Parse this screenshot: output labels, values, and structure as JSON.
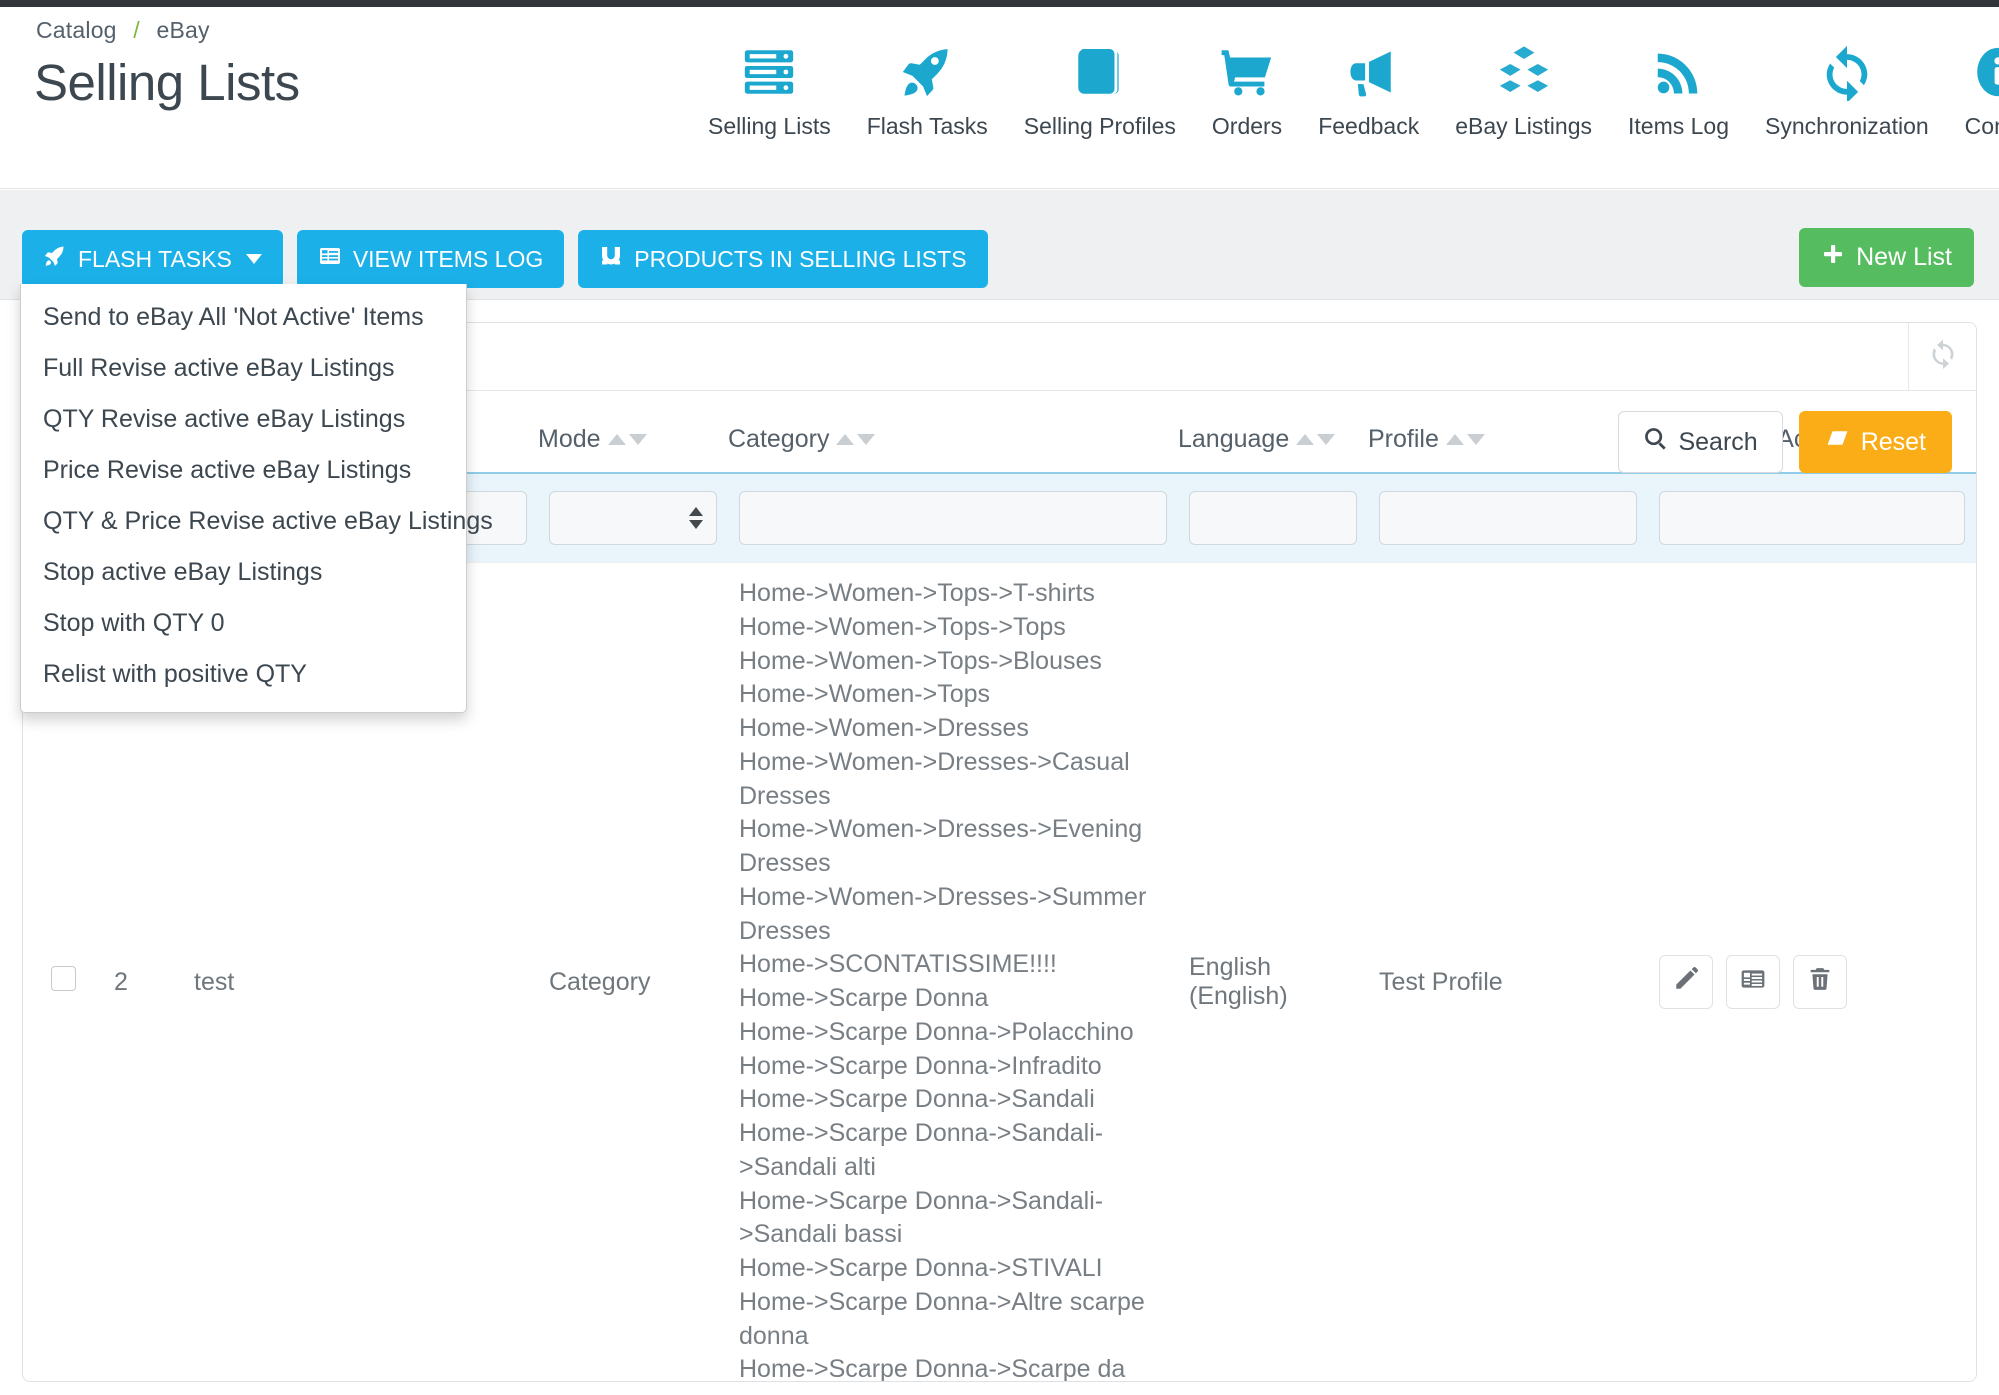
{
  "breadcrumb": {
    "root": "Catalog",
    "separator": "/",
    "current": "eBay"
  },
  "page_title": "Selling Lists",
  "colors": {
    "nav_icon": "#1ba7ce",
    "primary_button": "#1cb0e8",
    "new_button": "#55bd5f",
    "reset_button": "#fbad18",
    "filter_row_bg": "#e9f4fb",
    "breadcrumb_separator": "#7ab83e"
  },
  "nav": {
    "items": [
      {
        "label": "Selling Lists",
        "icon": "server-list-icon"
      },
      {
        "label": "Flash Tasks",
        "icon": "rocket-icon"
      },
      {
        "label": "Selling Profiles",
        "icon": "book-icon"
      },
      {
        "label": "Orders",
        "icon": "shopping-cart-icon"
      },
      {
        "label": "Feedback",
        "icon": "megaphone-icon"
      },
      {
        "label": "eBay Listings",
        "icon": "boxes-icon"
      },
      {
        "label": "Items Log",
        "icon": "rss-icon"
      },
      {
        "label": "Synchronization",
        "icon": "sync-icon"
      },
      {
        "label": "Config",
        "icon": "info-circle-icon"
      }
    ]
  },
  "toolbar": {
    "flash_tasks_label": "FLASH TASKS",
    "view_items_log_label": "VIEW ITEMS LOG",
    "products_in_selling_lists_label": "PRODUCTS IN SELLING LISTS",
    "new_list_label": "New List"
  },
  "flash_tasks_menu": {
    "open": true,
    "items": [
      "Send to eBay All 'Not Active' Items",
      "Full Revise active eBay Listings",
      "QTY Revise active eBay Listings",
      "Price Revise active eBay Listings",
      "QTY & Price Revise active eBay Listings",
      "Stop active eBay Listings",
      "Stop with QTY 0",
      "Relist with positive QTY"
    ]
  },
  "panel": {
    "search_label": "Search",
    "reset_label": "Reset",
    "refresh_icon": "refresh-icon"
  },
  "table": {
    "columns": [
      {
        "key": "select",
        "label": "",
        "sortable": false
      },
      {
        "key": "id",
        "label": "",
        "sortable": false
      },
      {
        "key": "name",
        "label": "",
        "sortable": false
      },
      {
        "key": "mode",
        "label": "Mode",
        "sortable": true
      },
      {
        "key": "category",
        "label": "Category",
        "sortable": true
      },
      {
        "key": "language",
        "label": "Language",
        "sortable": true
      },
      {
        "key": "profile",
        "label": "Profile",
        "sortable": true
      },
      {
        "key": "action",
        "label": "Action",
        "sortable": false
      }
    ],
    "filters": {
      "id": "",
      "name": "",
      "mode": "",
      "category": "",
      "language": "",
      "profile": "",
      "action": ""
    },
    "rows": [
      {
        "id": "2",
        "name": "test",
        "mode": "Category",
        "categories": [
          "Home->Women->Tops->T-shirts",
          "Home->Women->Tops->Tops",
          "Home->Women->Tops->Blouses",
          "Home->Women->Tops",
          "Home->Women->Dresses",
          "Home->Women->Dresses->Casual Dresses",
          "Home->Women->Dresses->Evening Dresses",
          "Home->Women->Dresses->Summer Dresses",
          "Home->SCONTATISSIME!!!!",
          "Home->Scarpe Donna",
          "Home->Scarpe Donna->Polacchino",
          "Home->Scarpe Donna->Infradito",
          "Home->Scarpe Donna->Sandali",
          "Home->Scarpe Donna->Sandali->Sandali alti",
          "Home->Scarpe Donna->Sandali->Sandali bassi",
          "Home->Scarpe Donna->STIVALI",
          "Home->Scarpe Donna->Altre scarpe donna",
          "Home->Scarpe Donna->Scarpe da"
        ],
        "language": "English (English)",
        "profile": "Test Profile",
        "actions": [
          "edit-icon",
          "list-items-icon",
          "delete-icon"
        ]
      }
    ]
  }
}
